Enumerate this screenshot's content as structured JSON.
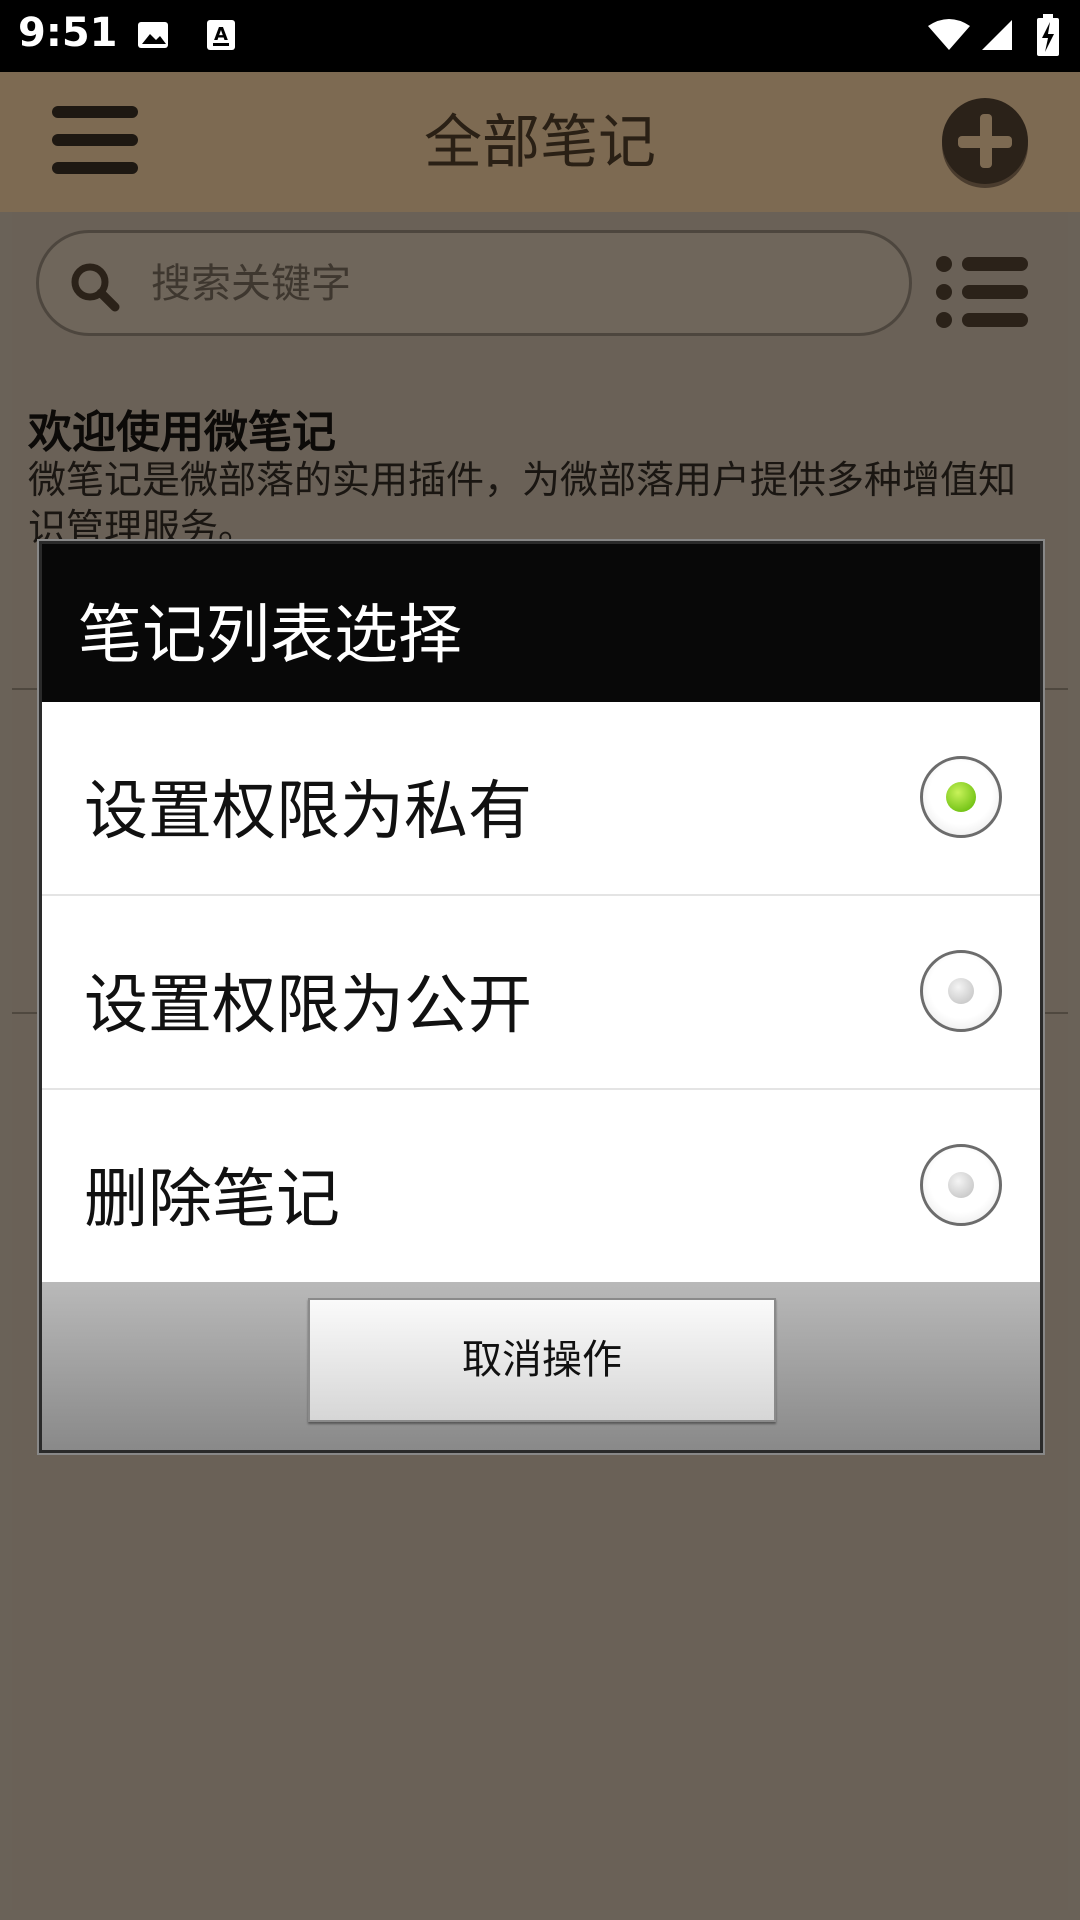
{
  "status_bar": {
    "time": "9:51"
  },
  "app_bar": {
    "title": "全部笔记"
  },
  "search": {
    "placeholder": "搜索关键字"
  },
  "note": {
    "title": "欢迎使用微笔记",
    "body": "微笔记是微部落的实用插件，为微部落用户提供多种增值知识管理服务。"
  },
  "dialog": {
    "title": "笔记列表选择",
    "options": [
      {
        "label": "设置权限为私有",
        "selected": true
      },
      {
        "label": "设置权限为公开",
        "selected": false
      },
      {
        "label": "删除笔记",
        "selected": false
      }
    ],
    "cancel_label": "取消操作"
  }
}
